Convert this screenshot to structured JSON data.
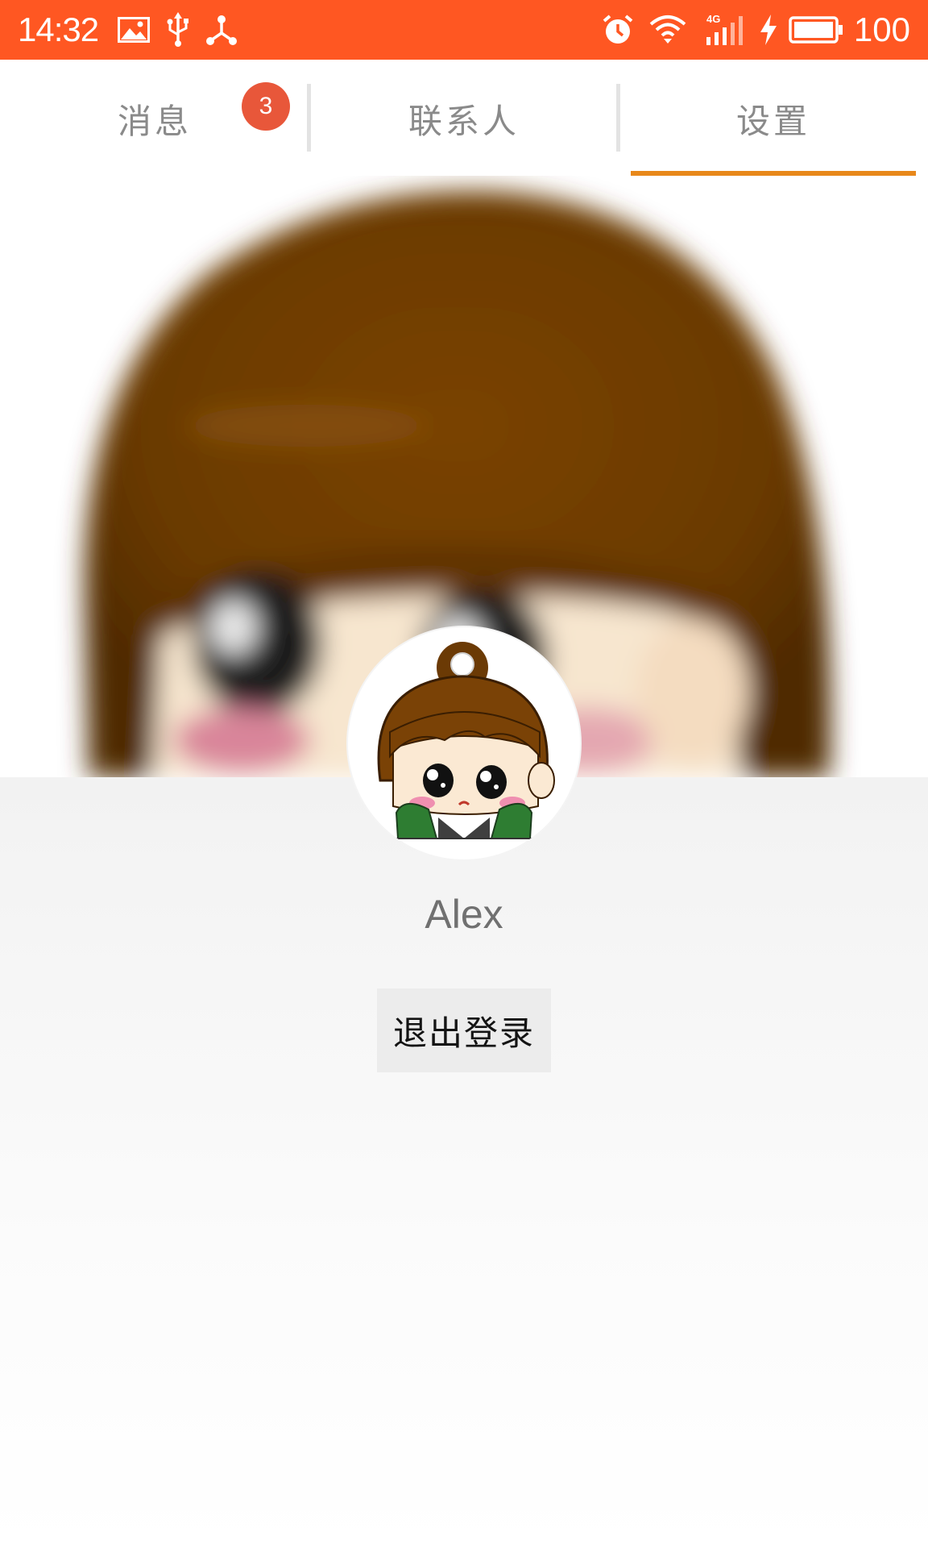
{
  "status_bar": {
    "time": "14:32",
    "battery_level": "100",
    "icons": [
      "gallery-icon",
      "usb-icon",
      "share-icon",
      "alarm-icon",
      "wifi-icon",
      "signal-4g-icon",
      "charging-icon",
      "battery-icon"
    ],
    "background_color": "#ff5722"
  },
  "tabs": [
    {
      "label": "消息",
      "badge": "3",
      "selected": false
    },
    {
      "label": "联系人",
      "selected": false
    },
    {
      "label": "设置",
      "selected": true
    }
  ],
  "accent_color": "#e8881a",
  "badge_color": "#e8573a",
  "profile": {
    "name": "Alex",
    "logout_label": "退出登录"
  }
}
